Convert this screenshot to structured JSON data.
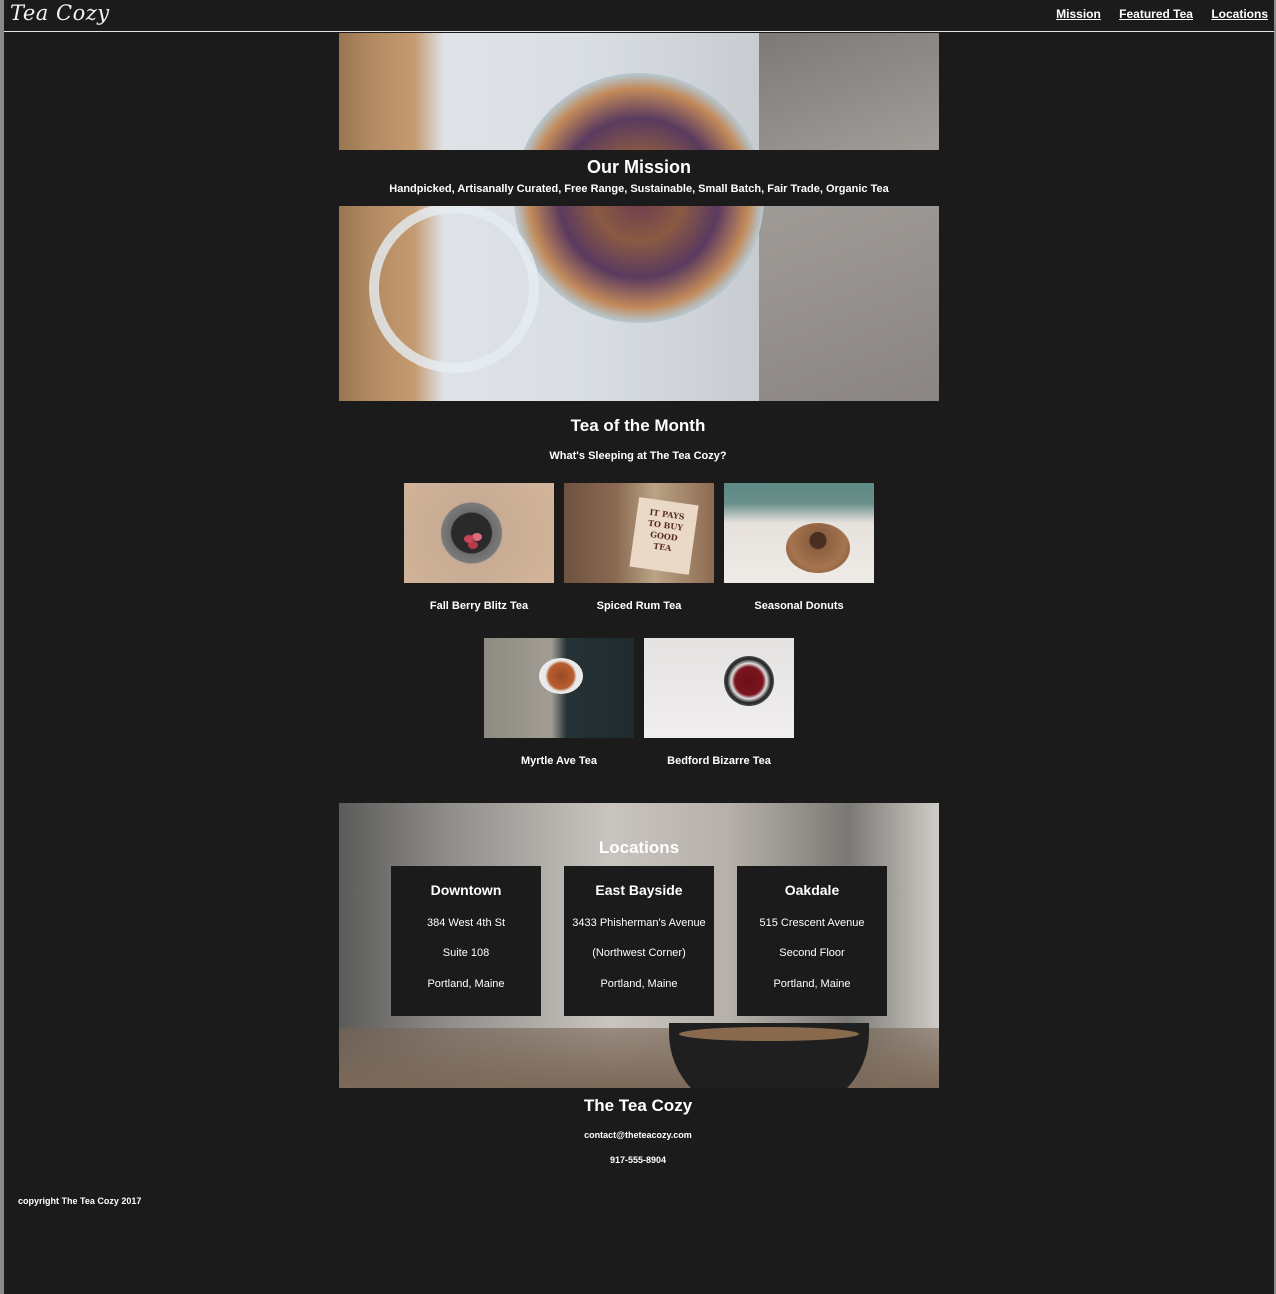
{
  "header": {
    "logo": "Tea Cozy",
    "nav": [
      "Mission",
      "Featured Tea",
      "Locations"
    ]
  },
  "mission": {
    "title": "Our Mission",
    "tagline": "Handpicked, Artisanally Curated, Free Range, Sustainable, Small Batch, Fair Trade, Organic Tea"
  },
  "tea_of_month": {
    "title": "Tea of the Month",
    "subtitle": "What's Sleeping at The Tea Cozy?",
    "items": [
      {
        "label": "Fall Berry Blitz Tea"
      },
      {
        "label": "Spiced Rum Tea"
      },
      {
        "label": "Seasonal Donuts"
      },
      {
        "label": "Myrtle Ave Tea"
      },
      {
        "label": "Bedford Bizarre Tea"
      }
    ]
  },
  "locations": {
    "title": "Locations",
    "cards": [
      {
        "name": "Downtown",
        "line1": "384 West 4th St",
        "line2": "Suite 108",
        "line3": "Portland, Maine"
      },
      {
        "name": "East Bayside",
        "line1": "3433 Phisherman's Avenue",
        "line2": "(Northwest Corner)",
        "line3": "Portland, Maine"
      },
      {
        "name": "Oakdale",
        "line1": "515 Crescent Avenue",
        "line2": "Second Floor",
        "line3": "Portland, Maine"
      }
    ]
  },
  "contact": {
    "title": "The Tea Cozy",
    "email": "contact@theteacozy.com",
    "phone": "917-555-8904"
  },
  "footer": {
    "copyright": "copyright The Tea Cozy 2017"
  }
}
